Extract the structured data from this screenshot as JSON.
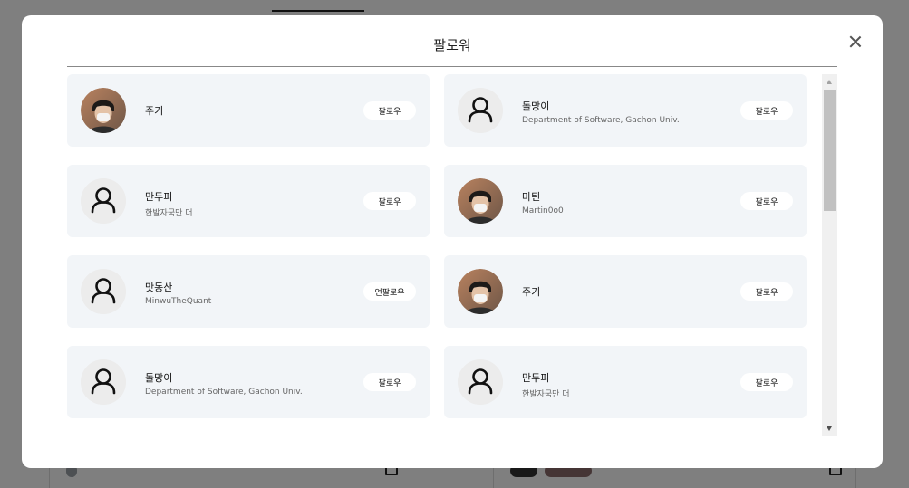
{
  "modal": {
    "title": "팔로워"
  },
  "followers": [
    {
      "name": "주기",
      "subtitle": "",
      "button": "팔로우",
      "avatar": "photo"
    },
    {
      "name": "돌망이",
      "subtitle": "Department of Software, Gachon Univ.",
      "button": "팔로우",
      "avatar": "default"
    },
    {
      "name": "만두피",
      "subtitle": "한발자국만 더",
      "button": "팔로우",
      "avatar": "default"
    },
    {
      "name": "마틴",
      "subtitle": "Martin0o0",
      "button": "팔로우",
      "avatar": "photo"
    },
    {
      "name": "맛동산",
      "subtitle": "MinwuTheQuant",
      "button": "언팔로우",
      "avatar": "default"
    },
    {
      "name": "주기",
      "subtitle": "",
      "button": "팔로우",
      "avatar": "photo"
    },
    {
      "name": "돌망이",
      "subtitle": "Department of Software, Gachon Univ.",
      "button": "팔로우",
      "avatar": "default"
    },
    {
      "name": "만두피",
      "subtitle": "한발자국만 더",
      "button": "팔로우",
      "avatar": "default"
    }
  ],
  "icons": {
    "close": "close-icon",
    "default_avatar": "user-icon",
    "scroll_up": "scroll-up-arrow-icon",
    "scroll_down": "scroll-down-arrow-icon"
  },
  "colors": {
    "card_bg": "#f2f5f8",
    "overlay": "rgba(0,0,0,0.5)",
    "modal_bg": "#ffffff"
  }
}
